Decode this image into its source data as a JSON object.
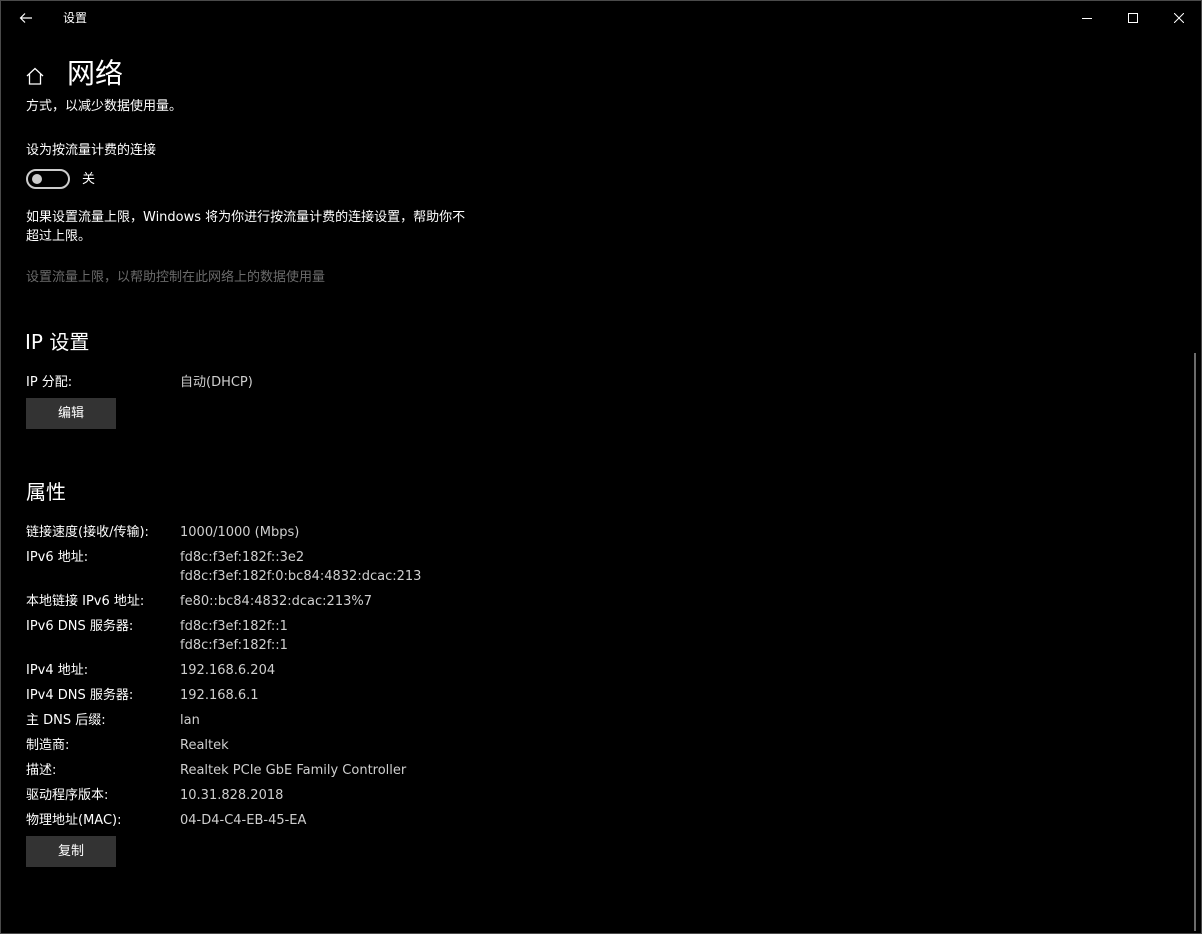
{
  "window": {
    "title": "设置",
    "back_icon": "back-arrow-icon",
    "minimize_icon": "minimize-icon",
    "maximize_icon": "maximize-icon",
    "close_icon": "close-icon"
  },
  "header": {
    "home_icon": "home-icon",
    "title": "网络"
  },
  "metered": {
    "description_tail": "方式，以减少数据使用量。",
    "label": "设为按流量计费的连接",
    "toggle_on": false,
    "toggle_state": "关",
    "limit_description": "如果设置流量上限，Windows 将为你进行按流量计费的连接设置，帮助你不超过上限。",
    "limit_link": "设置流量上限，以帮助控制在此网络上的数据使用量"
  },
  "ip_settings": {
    "heading": "IP 设置",
    "assign_label": "IP 分配:",
    "assign_value": "自动(DHCP)",
    "edit_button": "编辑"
  },
  "properties": {
    "heading": "属性",
    "rows": [
      {
        "label": "链接速度(接收/传输):",
        "values": [
          "1000/1000 (Mbps)"
        ]
      },
      {
        "label": "IPv6 地址:",
        "values": [
          "fd8c:f3ef:182f::3e2",
          "fd8c:f3ef:182f:0:bc84:4832:dcac:213"
        ]
      },
      {
        "label": "本地链接 IPv6 地址:",
        "values": [
          "fe80::bc84:4832:dcac:213%7"
        ]
      },
      {
        "label": "IPv6 DNS 服务器:",
        "values": [
          "fd8c:f3ef:182f::1",
          "fd8c:f3ef:182f::1"
        ]
      },
      {
        "label": "IPv4 地址:",
        "values": [
          "192.168.6.204"
        ]
      },
      {
        "label": "IPv4 DNS 服务器:",
        "values": [
          "192.168.6.1"
        ]
      },
      {
        "label": "主 DNS 后缀:",
        "values": [
          "lan"
        ]
      },
      {
        "label": "制造商:",
        "values": [
          "Realtek"
        ]
      },
      {
        "label": "描述:",
        "values": [
          "Realtek PCIe GbE Family Controller"
        ]
      },
      {
        "label": "驱动程序版本:",
        "values": [
          "10.31.828.2018"
        ]
      },
      {
        "label": "物理地址(MAC):",
        "values": [
          "04-D4-C4-EB-45-EA"
        ]
      }
    ],
    "copy_button": "复制"
  },
  "colors": {
    "background": "#000000",
    "text": "#ffffff",
    "secondary_text": "#cfcfcf",
    "disabled_text": "#6b6b6b",
    "button_bg": "#333333"
  }
}
